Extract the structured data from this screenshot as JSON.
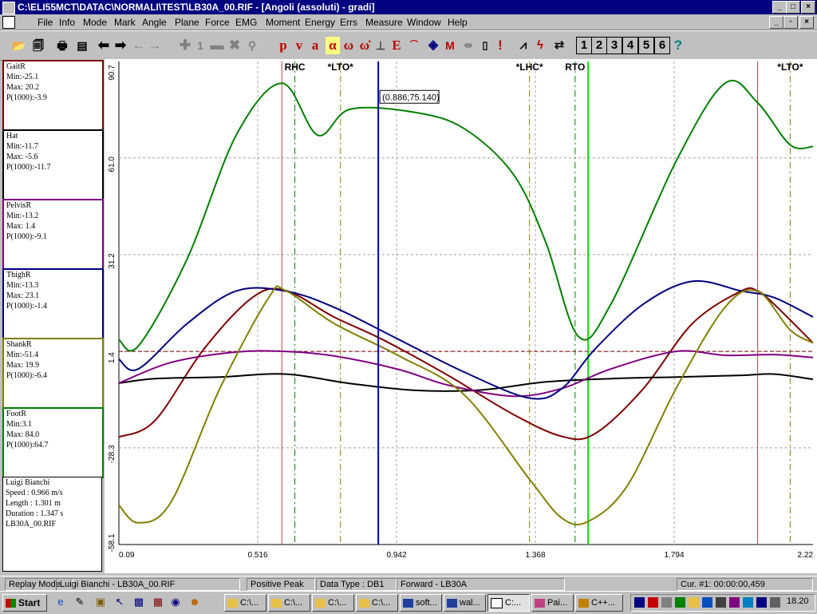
{
  "window": {
    "title": "C:\\ELI55MCT\\DATAC\\NORMALI\\TEST\\LB30A_00.RIF - [Angoli (assoluti) - gradi]"
  },
  "menu": [
    "File",
    "Info",
    "Mode",
    "Mark",
    "Angle",
    "Plane",
    "Force",
    "EMG",
    "Moment",
    "Energy",
    "Errs",
    "Measure",
    "Window",
    "Help"
  ],
  "toolbar": {
    "calc_buttons": [
      "p",
      "v",
      "a",
      "α",
      "ω",
      "ω̇"
    ],
    "number_buttons": [
      "1",
      "2",
      "3",
      "4",
      "5",
      "6"
    ],
    "help_label": "?",
    "one_label": "1",
    "m_label": "M"
  },
  "panels": [
    {
      "name": "GaitR",
      "min": "Min:-25.1",
      "max": "Max: 20.2",
      "p": "P(1000):-3.9",
      "color": "#800000"
    },
    {
      "name": "Hat",
      "min": "Min:-11.7",
      "max": "Max: -5.6",
      "p": "P(1000):-11.7",
      "color": "#000000"
    },
    {
      "name": "PelvisR",
      "min": "Min:-13.2",
      "max": "Max: 1.4",
      "p": "P(1000):-9.1",
      "color": "#800080"
    },
    {
      "name": "ThighR",
      "min": "Min:-13.3",
      "max": "Max: 23.1",
      "p": "P(1000):-1.4",
      "color": "#000080"
    },
    {
      "name": "ShankR",
      "min": "Min:-51.4",
      "max": "Max: 19.9",
      "p": "P(1000):-6.4",
      "color": "#808000"
    },
    {
      "name": "FootR",
      "min": "Min:3.1",
      "max": "Max: 84.0",
      "p": "P(1000):64.7",
      "color": "#008000"
    }
  ],
  "subject": {
    "name": "Luigi Bianchi",
    "speed": "Speed : 0.966 m/s",
    "length": "Length : 1.301 m",
    "duration": "Duration : 1.347 s",
    "file": "LB30A_00.RIF"
  },
  "chart_data": {
    "type": "line",
    "xlim": [
      0.09,
      2.22
    ],
    "ylim": [
      -58.1,
      90.7
    ],
    "x_ticks": [
      "0.09",
      "0.516",
      "0.942",
      "1.368",
      "1.794",
      "2.22"
    ],
    "y_ticks": [
      "90.7",
      "61.0",
      "31.2",
      "1.4",
      "-28.3",
      "-58.1"
    ],
    "event_labels": [
      {
        "label": "RHC",
        "x": 0.63
      },
      {
        "label": "*LTO*",
        "x": 0.77
      },
      {
        "label": "*LHC*",
        "x": 1.35
      },
      {
        "label": "RTO",
        "x": 1.49
      },
      {
        "label": "*LTO*",
        "x": 2.15
      }
    ],
    "events_solid": [
      0.59,
      2.05
    ],
    "cursor": {
      "x": 0.886,
      "y": 75.14,
      "label": "(0.886;75.140)"
    },
    "green_marker": 1.53,
    "reference_y": 1.4,
    "series": [
      {
        "name": "GaitR",
        "color": "#800000",
        "x": [
          0.09,
          0.2,
          0.35,
          0.5,
          0.6,
          0.75,
          0.9,
          1.1,
          1.3,
          1.45,
          1.55,
          1.7,
          1.85,
          2.0,
          2.05,
          2.1,
          2.22
        ],
        "y": [
          -25,
          -20,
          2,
          18,
          20.2,
          12,
          5,
          -6,
          -18,
          -24.8,
          -24,
          -10,
          10,
          20,
          20,
          16,
          4
        ]
      },
      {
        "name": "Hat",
        "color": "#000000",
        "x": [
          0.09,
          0.2,
          0.4,
          0.6,
          0.8,
          1.0,
          1.2,
          1.4,
          1.6,
          1.8,
          2.0,
          2.1,
          2.22
        ],
        "y": [
          -8.4,
          -7,
          -6.5,
          -5.6,
          -8.5,
          -10.6,
          -10.5,
          -8,
          -7,
          -6.5,
          -6,
          -5.6,
          -7.2
        ]
      },
      {
        "name": "PelvisR",
        "color": "#800080",
        "x": [
          0.09,
          0.25,
          0.45,
          0.6,
          0.75,
          0.95,
          1.1,
          1.3,
          1.45,
          1.6,
          1.8,
          1.95,
          2.1,
          2.22
        ],
        "y": [
          -8.4,
          -2,
          1.2,
          1.4,
          0,
          -4.2,
          -9,
          -12.4,
          -10,
          -4,
          1.4,
          0.2,
          0.4,
          -0.5
        ]
      },
      {
        "name": "ThighR",
        "color": "#000080",
        "x": [
          0.09,
          0.15,
          0.3,
          0.45,
          0.6,
          0.75,
          0.95,
          1.15,
          1.35,
          1.45,
          1.55,
          1.7,
          1.85,
          2.0,
          2.1,
          2.22
        ],
        "y": [
          -1,
          -4,
          10,
          20,
          20,
          15,
          5,
          -5,
          -13,
          -10,
          2,
          16,
          23,
          20,
          18,
          12
        ]
      },
      {
        "name": "ShankR",
        "color": "#808000",
        "x": [
          0.09,
          0.15,
          0.25,
          0.4,
          0.55,
          0.6,
          0.75,
          0.95,
          1.15,
          1.35,
          1.45,
          1.53,
          1.65,
          1.8,
          1.95,
          2.05,
          2.15,
          2.22
        ],
        "y": [
          -46,
          -51.4,
          -45,
          -10,
          18,
          20.2,
          10,
          0,
          -12,
          -38,
          -50,
          -51,
          -40,
          -10,
          15,
          19.9,
          8,
          4
        ]
      },
      {
        "name": "FootR",
        "color": "#008000",
        "x": [
          0.09,
          0.15,
          0.3,
          0.45,
          0.59,
          0.7,
          0.8,
          1.0,
          1.15,
          1.3,
          1.4,
          1.5,
          1.6,
          1.8,
          1.95,
          2.05,
          2.15,
          2.22
        ],
        "y": [
          5,
          3.1,
          30,
          68,
          84,
          68,
          76,
          75,
          70,
          56,
          35,
          6,
          16,
          60,
          84,
          78,
          65,
          64.5
        ]
      }
    ]
  },
  "status": {
    "mode": "Replay Mode",
    "subject_file": "Luigi Bianchi - LB30A_00.RIF",
    "peak": "Positive Peak",
    "data_type": "Data Type : DB1",
    "direction": "Forward - LB30A",
    "cursor": "Cur. #1: 00:00:00,459"
  },
  "taskbar": {
    "start": "Start",
    "tasks": [
      "C:\\...",
      "C:\\...",
      "C:\\...",
      "C:\\...",
      "soft...",
      "wal...",
      "C:...",
      "Pai...",
      "C++..."
    ],
    "clock": "18.20"
  }
}
